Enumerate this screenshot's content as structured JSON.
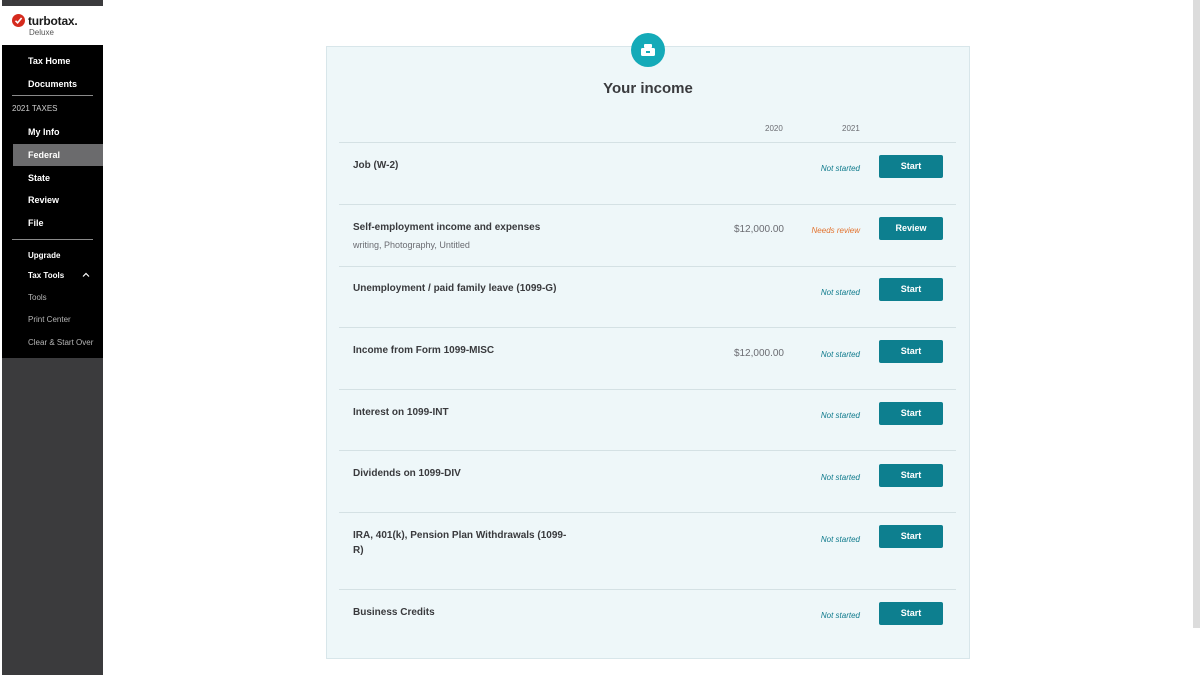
{
  "app": {
    "brand": "turbotax.",
    "edition": "Deluxe"
  },
  "sidebar": {
    "top_items": [
      {
        "label": "Tax Home"
      },
      {
        "label": "Documents"
      }
    ],
    "section_label": "2021 TAXES",
    "tax_items": [
      {
        "label": "My Info"
      },
      {
        "label": "Federal",
        "selected": true
      },
      {
        "label": "State"
      },
      {
        "label": "Review"
      },
      {
        "label": "File"
      }
    ],
    "upgrade_label": "Upgrade",
    "tools_label": "Tax Tools",
    "tools_sub": [
      {
        "label": "Tools"
      },
      {
        "label": "Print Center"
      },
      {
        "label": "Clear & Start Over"
      }
    ]
  },
  "main": {
    "icon": "cash-register-icon",
    "title": "Your income",
    "col_2020": "2020",
    "col_2021": "2021",
    "rows": [
      {
        "label": "Job (W-2)",
        "sub": "",
        "amount": "",
        "status": "Not started",
        "button": "Start"
      },
      {
        "label": "Self-employment income and expenses",
        "sub": "writing, Photography, Untitled",
        "amount": "$12,000.00",
        "status": "Needs review",
        "button": "Review"
      },
      {
        "label": "Unemployment / paid family leave (1099-G)",
        "sub": "",
        "amount": "",
        "status": "Not started",
        "button": "Start"
      },
      {
        "label": "Income from Form 1099-MISC",
        "sub": "",
        "amount": "$12,000.00",
        "status": "Not started",
        "button": "Start"
      },
      {
        "label": "Interest on 1099-INT",
        "sub": "",
        "amount": "",
        "status": "Not started",
        "button": "Start"
      },
      {
        "label": "Dividends on 1099-DIV",
        "sub": "",
        "amount": "",
        "status": "Not started",
        "button": "Start"
      },
      {
        "label": "IRA, 401(k), Pension Plan Withdrawals (1099-R)",
        "sub": "",
        "amount": "",
        "status": "Not started",
        "button": "Start"
      },
      {
        "label": "Business Credits",
        "sub": "",
        "amount": "",
        "status": "Not started",
        "button": "Start"
      }
    ]
  },
  "colors": {
    "accent": "#0d7f8f",
    "badge": "#14aab8",
    "review": "#e3732f",
    "card_bg": "#eef7f9"
  }
}
